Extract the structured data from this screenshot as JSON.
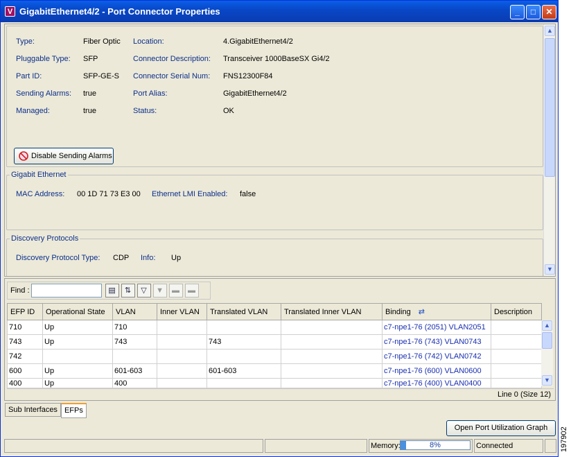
{
  "window": {
    "title": "GigabitEthernet4/2 - Port Connector Properties",
    "icon_letter": "V"
  },
  "properties": {
    "type_label": "Type:",
    "type_value": "Fiber Optic",
    "location_label": "Location:",
    "location_value": "4.GigabitEthernet4/2",
    "pluggable_label": "Pluggable Type:",
    "pluggable_value": "SFP",
    "conndesc_label": "Connector Description:",
    "conndesc_value": "Transceiver 1000BaseSX Gi4/2",
    "partid_label": "Part ID:",
    "partid_value": "SFP-GE-S",
    "serial_label": "Connector Serial Num:",
    "serial_value": "FNS12300F84",
    "alarms_label": "Sending Alarms:",
    "alarms_value": "true",
    "alias_label": "Port Alias:",
    "alias_value": "GigabitEthernet4/2",
    "managed_label": "Managed:",
    "managed_value": "true",
    "status_label": "Status:",
    "status_value": "OK",
    "disable_alarms_button": "Disable Sending Alarms"
  },
  "gigabit": {
    "legend": "Gigabit Ethernet",
    "mac_label": "MAC Address:",
    "mac_value": "00 1D 71 73 E3 00",
    "lmi_label": "Ethernet LMI Enabled:",
    "lmi_value": "false"
  },
  "discovery": {
    "legend": "Discovery Protocols",
    "type_label": "Discovery Protocol Type:",
    "type_value": "CDP",
    "info_label": "Info:",
    "info_value": "Up"
  },
  "find": {
    "label": "Find :",
    "value": ""
  },
  "table": {
    "columns": [
      "EFP ID",
      "Operational State",
      "VLAN",
      "Inner VLAN",
      "Translated VLAN",
      "Translated Inner VLAN",
      "Binding",
      "Description"
    ],
    "rows": [
      [
        "710",
        "Up",
        "710",
        "",
        "",
        "",
        "c7-npe1-76 (2051) VLAN2051",
        ""
      ],
      [
        "743",
        "Up",
        "743",
        "",
        "743",
        "",
        "c7-npe1-76 (743) VLAN0743",
        ""
      ],
      [
        "742",
        "",
        "",
        "",
        "",
        "",
        "c7-npe1-76 (742) VLAN0742",
        ""
      ],
      [
        "600",
        "Up",
        "601-603",
        "",
        "601-603",
        "",
        "c7-npe1-76 (600) VLAN0600",
        ""
      ],
      [
        "400",
        "Up",
        "400",
        "",
        "",
        "",
        "c7-npe1-76 (400) VLAN0400",
        ""
      ]
    ],
    "line_status": "Line 0 (Size 12)"
  },
  "tabs": {
    "sub_interfaces": "Sub Interfaces",
    "efps": "EFPs"
  },
  "open_graph_button": "Open Port Utilization Graph",
  "statusbar": {
    "memory_label": "Memory:",
    "memory_percent": "8%",
    "memory_fraction": 0.08,
    "connection": "Connected"
  },
  "figure_number": "197902",
  "colors": {
    "label_blue": "#0b2f8c",
    "binding_blue": "#1a2fb0",
    "titlebar": "#0848c8"
  }
}
